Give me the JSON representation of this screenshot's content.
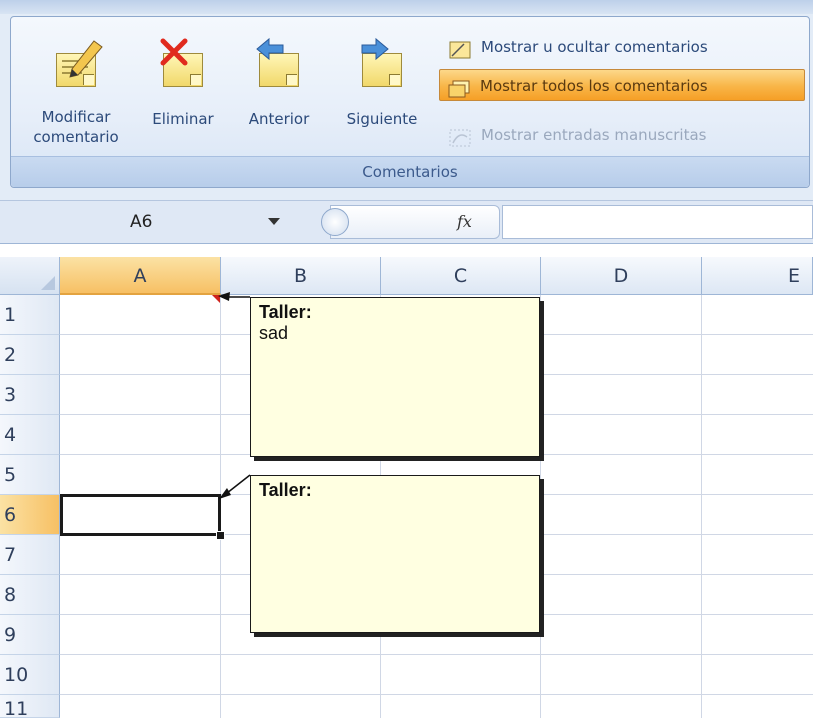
{
  "ribbon": {
    "group_caption": "Comentarios",
    "big_buttons": [
      {
        "label_line1": "Modificar",
        "label_line2": "comentario",
        "icon": "edit-comment-icon"
      },
      {
        "label_line1": "Eliminar",
        "label_line2": "",
        "icon": "delete-comment-icon"
      },
      {
        "label_line1": "Anterior",
        "label_line2": "",
        "icon": "previous-comment-icon"
      },
      {
        "label_line1": "Siguiente",
        "label_line2": "",
        "icon": "next-comment-icon"
      }
    ],
    "small_buttons": [
      {
        "label": "Mostrar u ocultar comentarios",
        "icon": "show-hide-comment-icon",
        "state": "normal"
      },
      {
        "label": "Mostrar todos los comentarios",
        "icon": "show-all-comments-icon",
        "state": "active"
      },
      {
        "label": "Mostrar entradas manuscritas",
        "icon": "ink-icon",
        "state": "disabled"
      }
    ]
  },
  "formula_bar": {
    "name_box": "A6",
    "fx_label": "fx",
    "value": ""
  },
  "sheet": {
    "columns": [
      "A",
      "B",
      "C",
      "D",
      "E"
    ],
    "rows": [
      "1",
      "2",
      "3",
      "4",
      "5",
      "6",
      "7",
      "8",
      "9",
      "10",
      "11"
    ],
    "selected_column": "A",
    "selected_row": "6",
    "active_cell": "A6"
  },
  "comments": [
    {
      "author": "Taller:",
      "text": "sad",
      "anchor_cell": "A1"
    },
    {
      "author": "Taller:",
      "text": "",
      "anchor_cell": "A6"
    }
  ],
  "colors": {
    "ribbon_text": "#2c4a7a",
    "active_button": "#f8b547",
    "selected_header": "#f7c064",
    "comment_bg": "#ffffe1",
    "indicator": "#d0241c"
  }
}
